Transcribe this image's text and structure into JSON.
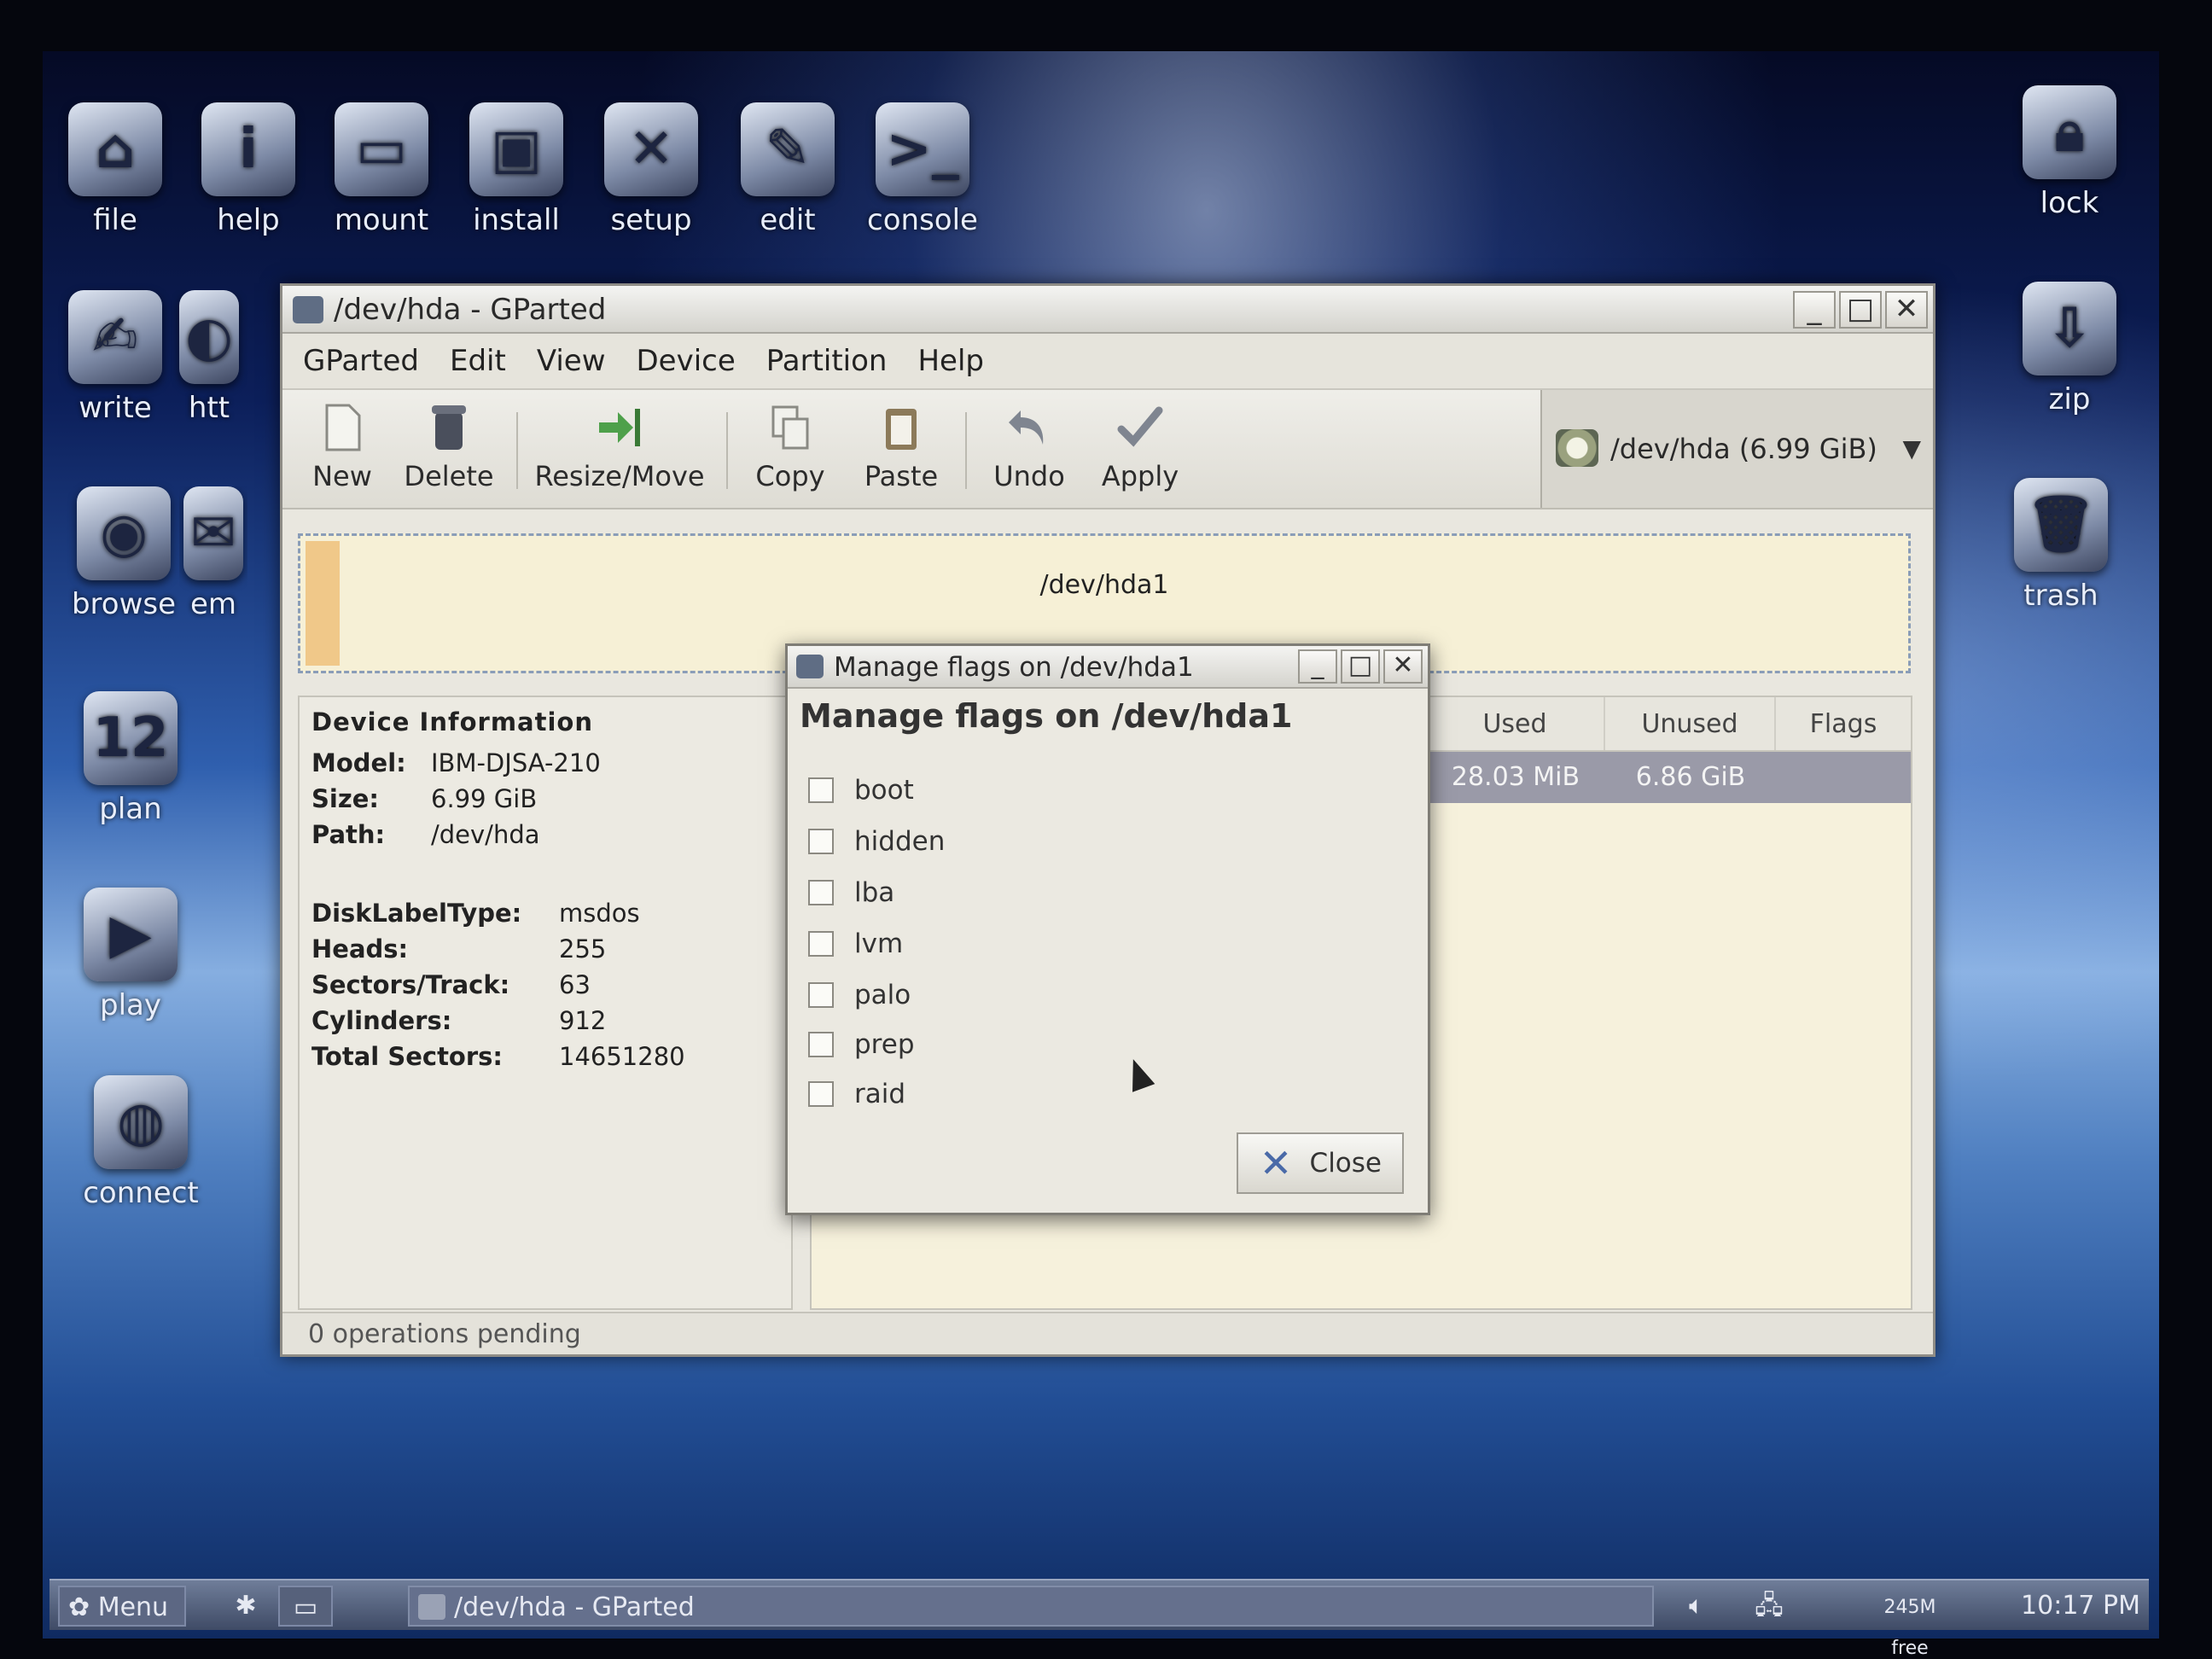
{
  "desktop": {
    "icons_top": [
      {
        "name": "file",
        "label": "file"
      },
      {
        "name": "help",
        "label": "help"
      },
      {
        "name": "mount",
        "label": "mount"
      },
      {
        "name": "install",
        "label": "install"
      },
      {
        "name": "setup",
        "label": "setup"
      },
      {
        "name": "edit",
        "label": "edit"
      },
      {
        "name": "console",
        "label": "console"
      }
    ],
    "icons_left": [
      {
        "label": "write"
      },
      {
        "label": "htt"
      },
      {
        "label": "browse"
      },
      {
        "label": "em"
      },
      {
        "label": "plan",
        "badge": "12"
      },
      {
        "label": "play"
      },
      {
        "label": "connect"
      }
    ],
    "icons_right": [
      {
        "label": "lock"
      },
      {
        "label": "zip"
      },
      {
        "label": "trash"
      }
    ]
  },
  "gparted": {
    "title": "/dev/hda - GParted",
    "menu": [
      "GParted",
      "Edit",
      "View",
      "Device",
      "Partition",
      "Help"
    ],
    "toolbar": {
      "new": "New",
      "delete": "Delete",
      "resize_move": "Resize/Move",
      "copy": "Copy",
      "paste": "Paste",
      "undo": "Undo",
      "apply": "Apply"
    },
    "device_selector": "/dev/hda  (6.99 GiB)",
    "partition_map_label": "/dev/hda1",
    "device_info": {
      "header": "Device Information",
      "model_label": "Model:",
      "model": "IBM-DJSA-210",
      "size_label": "Size:",
      "size": "6.99 GiB",
      "path_label": "Path:",
      "path": "/dev/hda",
      "disklabel_label": "DiskLabelType:",
      "disklabel": "msdos",
      "heads_label": "Heads:",
      "heads": "255",
      "sectors_label": "Sectors/Track:",
      "sectors": "63",
      "cylinders_label": "Cylinders:",
      "cylinders": "912",
      "total_label": "Total Sectors:",
      "total": "14651280"
    },
    "table": {
      "headers": {
        "used": "Used",
        "unused": "Unused",
        "flags": "Flags"
      },
      "row": {
        "used": "28.03 MiB",
        "unused": "6.86 GiB",
        "flags": ""
      }
    },
    "status": "0 operations pending"
  },
  "dialog": {
    "title": "Manage flags on /dev/hda1",
    "heading": "Manage flags on /dev/hda1",
    "flags": [
      "boot",
      "hidden",
      "lba",
      "lvm",
      "palo",
      "prep",
      "raid"
    ],
    "close": "Close"
  },
  "taskbar": {
    "menu": "Menu",
    "task": "/dev/hda - GParted",
    "mem_value": "245M",
    "mem_label": "free",
    "clock": "10:17 PM"
  }
}
